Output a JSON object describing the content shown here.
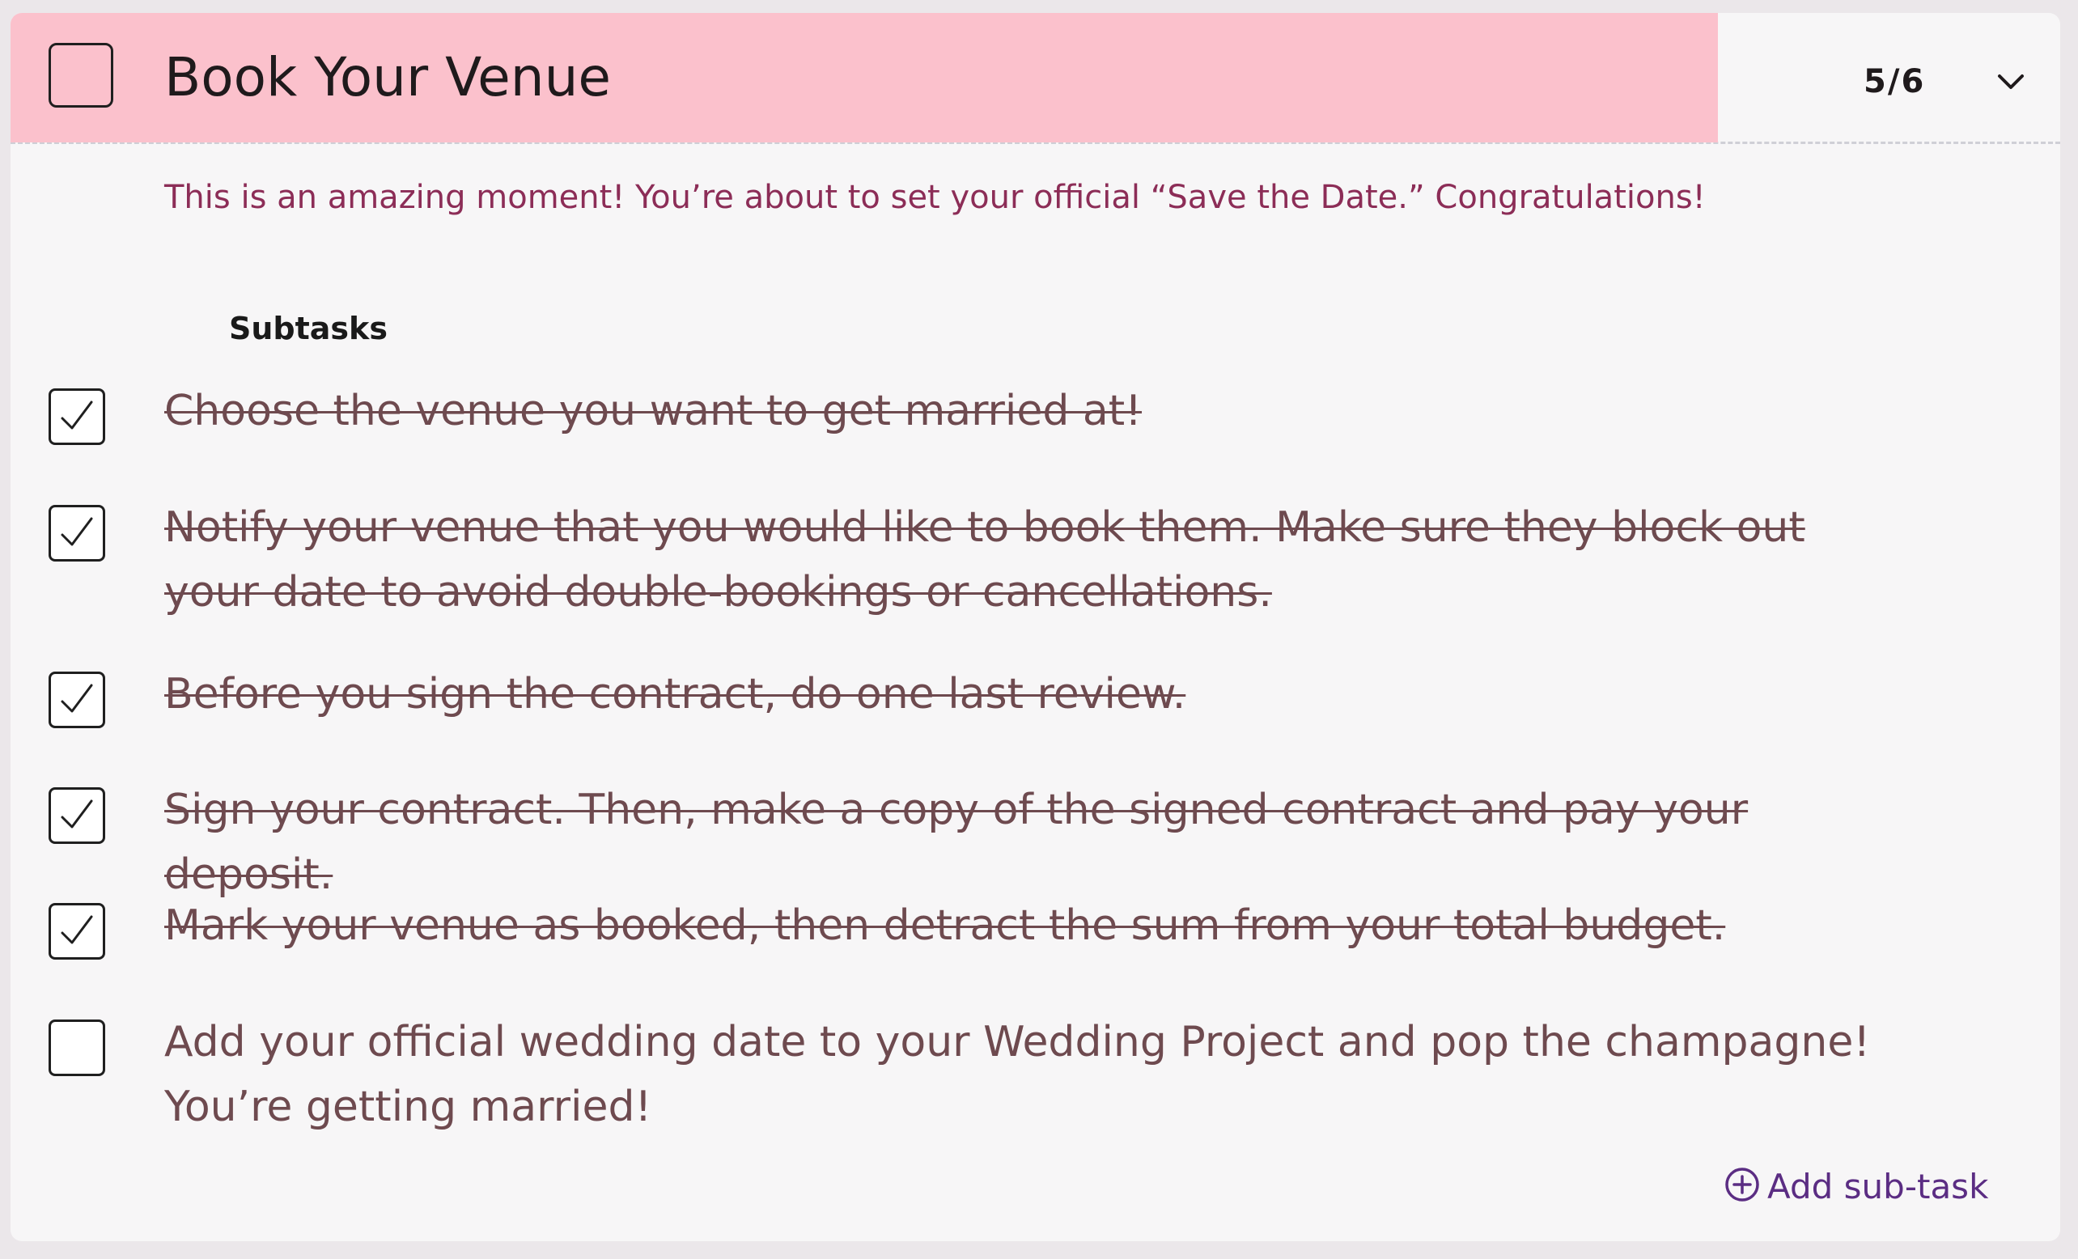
{
  "task": {
    "title": "Book Your Venue",
    "counter": "5/6",
    "description": "This is an amazing moment! You’re about to set your official “Save the Date.” Congratulations!",
    "completed": false
  },
  "subtasks": {
    "heading": "Subtasks",
    "items": [
      {
        "text": "Choose the venue you want to get married at!",
        "done": true
      },
      {
        "text": "Notify your venue that you would like to book them. Make sure they block out your date to avoid double-bookings or cancellations.",
        "done": true
      },
      {
        "text": "Before you sign the contract, do one last review.",
        "done": true
      },
      {
        "text": "Sign your contract. Then, make a copy of the signed contract and pay your deposit.",
        "done": true
      },
      {
        "text": "Mark your venue as booked, then detract the sum from your total budget.",
        "done": true
      },
      {
        "text": "Add your official wedding date to your Wedding Project and pop the champagne! You’re getting married!",
        "done": false
      }
    ],
    "add_label": "Add sub-task"
  },
  "colors": {
    "header_bg": "#fbc1cc",
    "description": "#8c2d57",
    "subtask_text": "#6e4a4f",
    "accent": "#5b2d83"
  },
  "icons": {
    "expand": "chevron-down-icon",
    "check": "checkmark-icon",
    "add": "plus-circle-icon"
  }
}
